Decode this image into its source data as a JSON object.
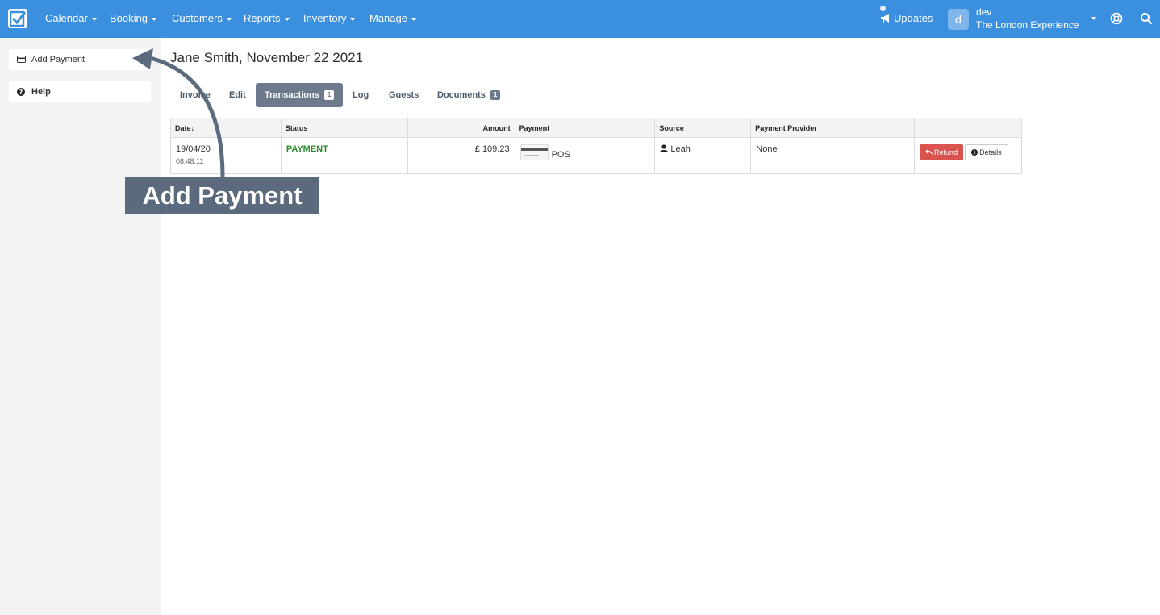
{
  "nav": {
    "menu": [
      {
        "label": "Calendar"
      },
      {
        "label": "Booking"
      },
      {
        "label": "Customers"
      },
      {
        "label": "Reports"
      },
      {
        "label": "Inventory"
      },
      {
        "label": "Manage"
      }
    ],
    "updates_label": "Updates",
    "user": {
      "initial": "d",
      "name": "dev",
      "company": "The London Experience"
    },
    "color": "#3a8fde"
  },
  "sidebar": {
    "add_payment_label": "Add Payment",
    "help_label": "Help"
  },
  "main": {
    "title": "Jane Smith, November 22 2021",
    "tabs": [
      {
        "label": "Invoice"
      },
      {
        "label": "Edit"
      },
      {
        "label": "Transactions",
        "badge": "1"
      },
      {
        "label": "Log"
      },
      {
        "label": "Guests"
      },
      {
        "label": "Documents",
        "badge": "1"
      }
    ],
    "table": {
      "headers": {
        "date": "Date",
        "status": "Status",
        "amount": "Amount",
        "payment": "Payment",
        "source": "Source",
        "provider": "Payment Provider"
      },
      "rows": [
        {
          "date": "19/04/20",
          "time": "08:48:11",
          "status": "PAYMENT",
          "amount": "£ 109.23",
          "payment": "POS",
          "source": "Leah",
          "provider": "None",
          "refund_label": "Refund",
          "details_label": "Details"
        }
      ]
    }
  },
  "overlay": {
    "callout_text": "Add Payment"
  }
}
